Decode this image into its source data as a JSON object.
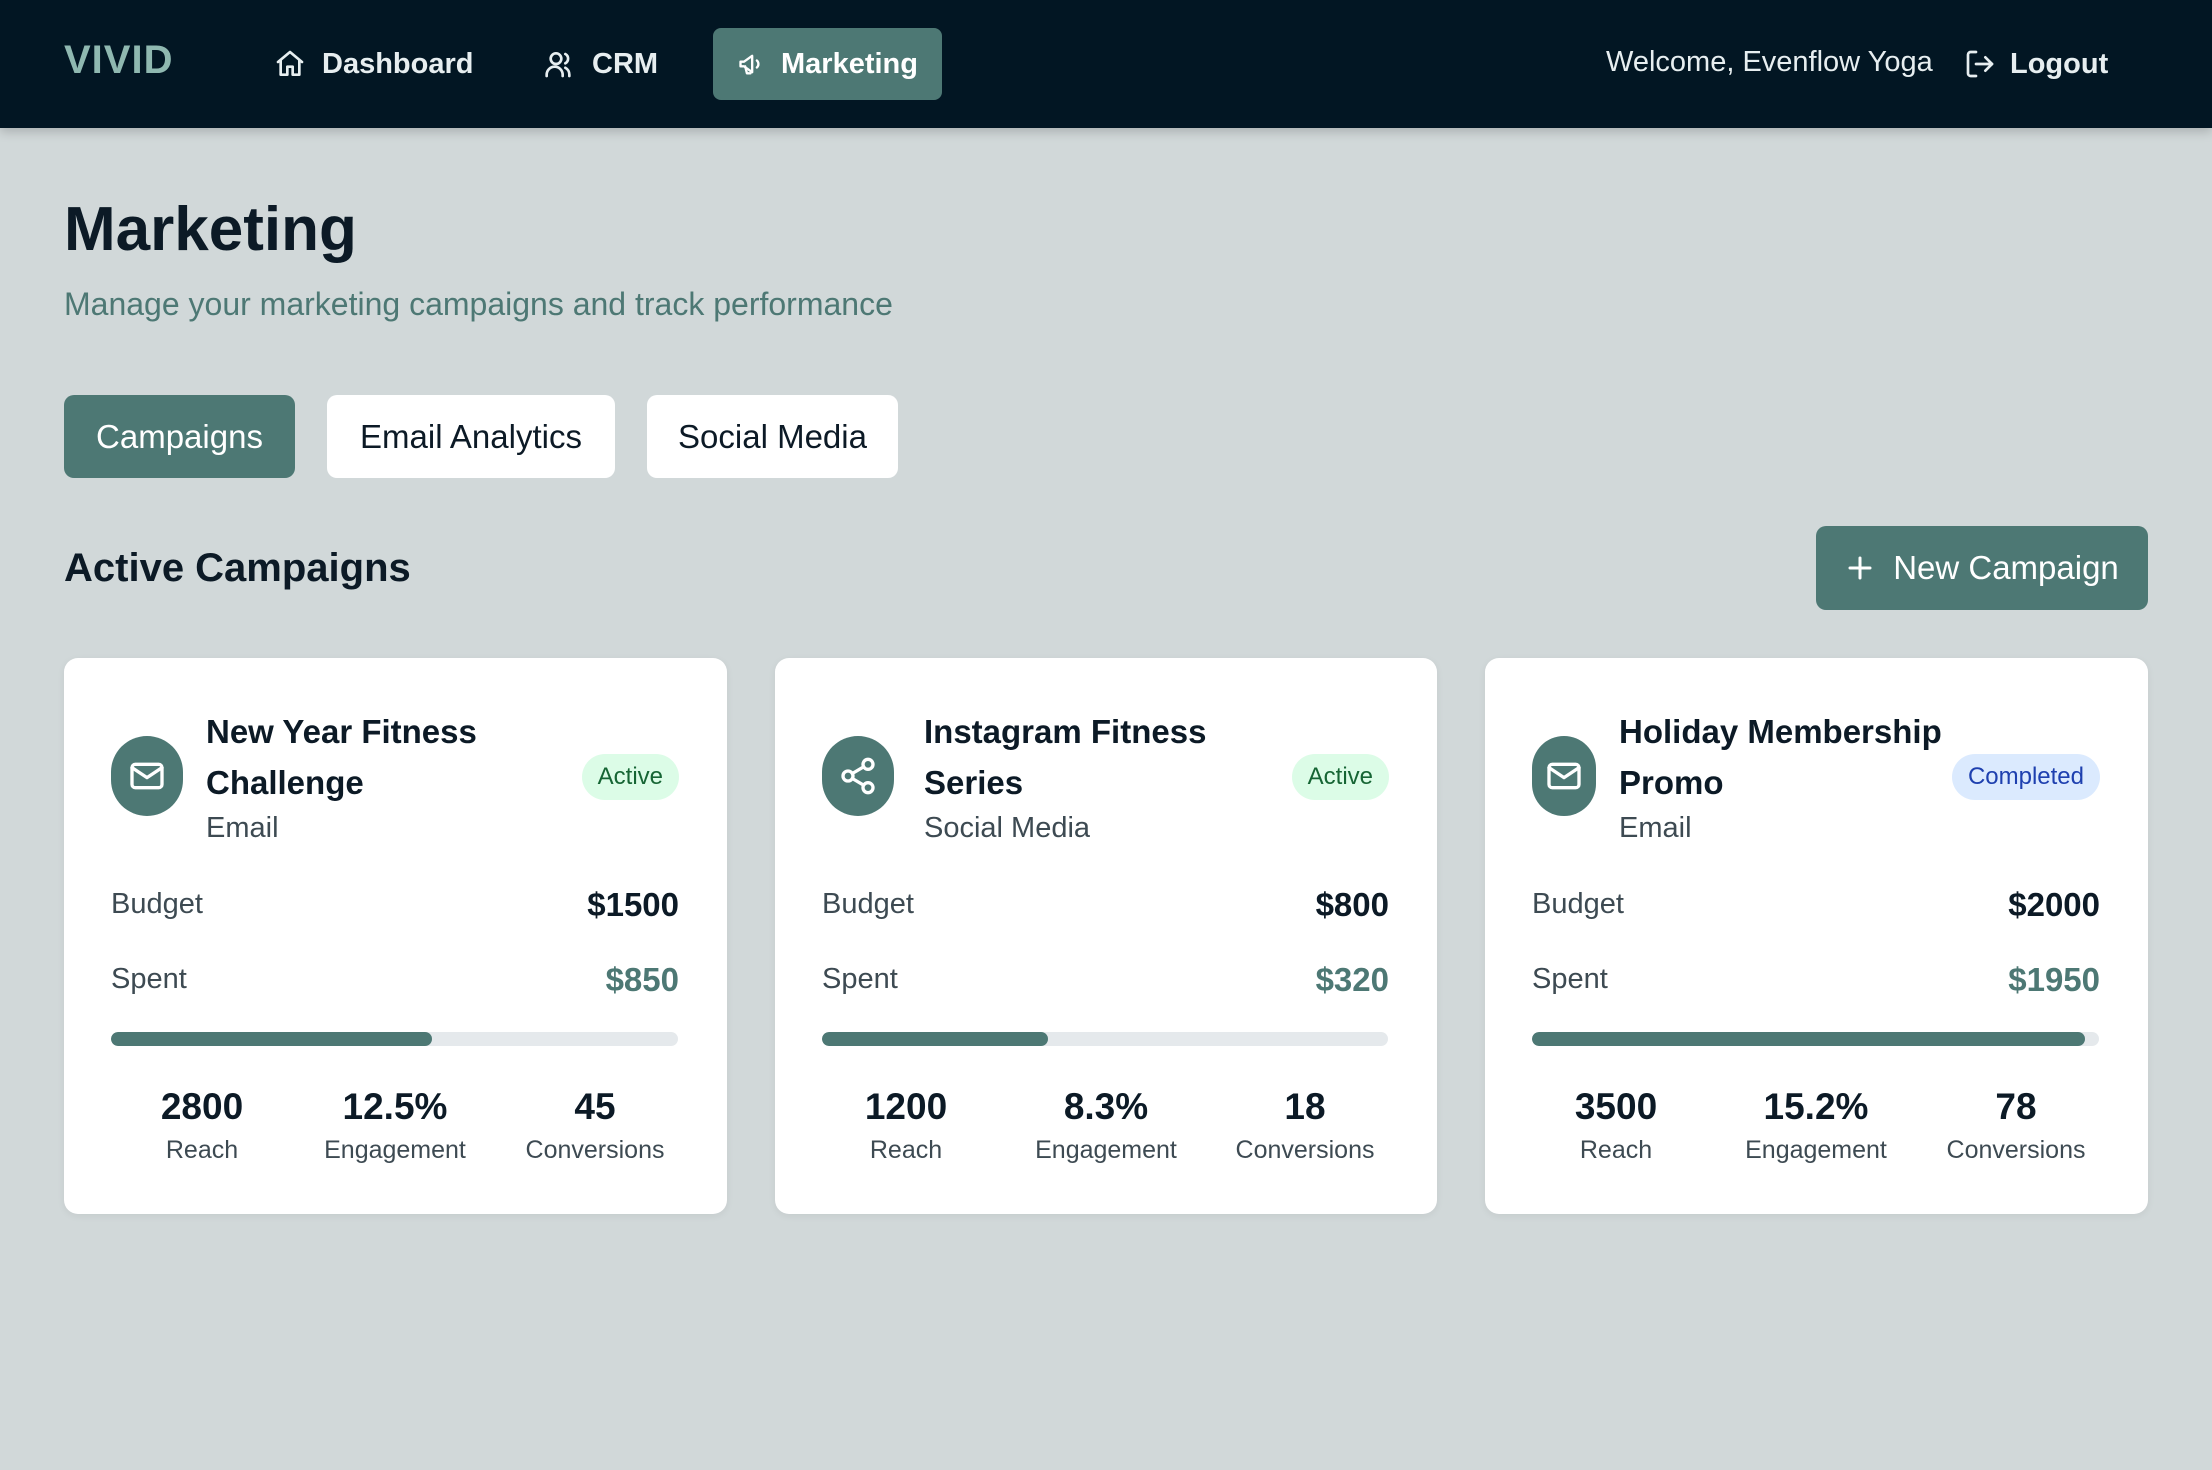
{
  "brand": "VIVID",
  "nav": {
    "dashboard": "Dashboard",
    "crm": "CRM",
    "marketing": "Marketing"
  },
  "welcome": "Welcome, Evenflow Yoga",
  "logout": "Logout",
  "page": {
    "title": "Marketing",
    "subtitle": "Manage your marketing campaigns and track performance"
  },
  "tabs": [
    {
      "label": "Campaigns",
      "active": true
    },
    {
      "label": "Email Analytics",
      "active": false
    },
    {
      "label": "Social Media",
      "active": false
    }
  ],
  "section": {
    "title": "Active Campaigns",
    "new_button": "New Campaign"
  },
  "labels": {
    "budget": "Budget",
    "spent": "Spent",
    "reach": "Reach",
    "engagement": "Engagement",
    "conversions": "Conversions"
  },
  "campaigns": [
    {
      "name": "New Year Fitness Challenge",
      "type": "Email",
      "icon": "mail-icon",
      "status": "Active",
      "budget": "$1500",
      "spent": "$850",
      "spent_fraction": 0.567,
      "reach": "2800",
      "engagement": "12.5%",
      "conversions": "45"
    },
    {
      "name": "Instagram Fitness Series",
      "type": "Social Media",
      "icon": "share-icon",
      "status": "Active",
      "budget": "$800",
      "spent": "$320",
      "spent_fraction": 0.4,
      "reach": "1200",
      "engagement": "8.3%",
      "conversions": "18"
    },
    {
      "name": "Holiday Membership Promo",
      "type": "Email",
      "icon": "mail-icon",
      "status": "Completed",
      "budget": "$2000",
      "spent": "$1950",
      "spent_fraction": 0.975,
      "reach": "3500",
      "engagement": "15.2%",
      "conversions": "78"
    }
  ],
  "colors": {
    "header_bg": "#021623",
    "accent": "#4d7874",
    "page_bg": "#d1d8d9",
    "active_badge_bg": "#dcfce7",
    "active_badge_text": "#166534",
    "completed_badge_bg": "#dbeafe",
    "completed_badge_text": "#1e40af"
  }
}
